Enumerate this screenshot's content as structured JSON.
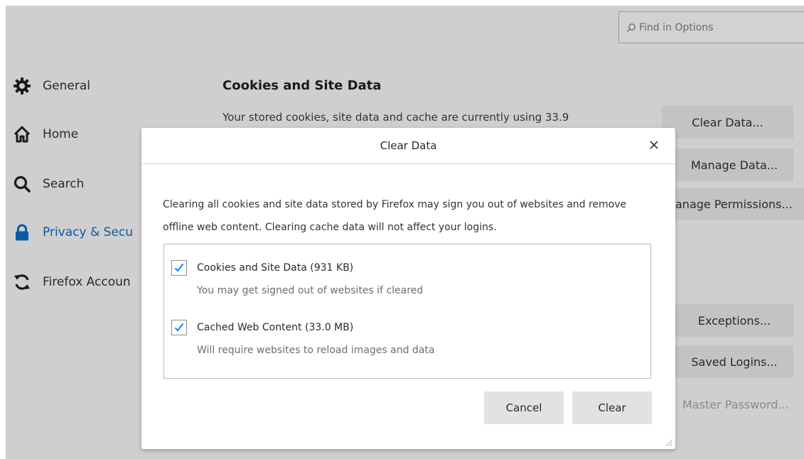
{
  "search": {
    "placeholder": "Find in Options"
  },
  "sidebar": {
    "items": [
      {
        "label": "General",
        "icon": "gear-icon"
      },
      {
        "label": "Home",
        "icon": "home-icon"
      },
      {
        "label": "Search",
        "icon": "search-icon"
      },
      {
        "label": "Privacy & Secu",
        "icon": "lock-icon",
        "active": true
      },
      {
        "label": "Firefox Accoun",
        "icon": "sync-icon"
      }
    ]
  },
  "content": {
    "section_title": "Cookies and Site Data",
    "section_desc": "Your stored cookies, site data and cache are currently using 33.9"
  },
  "side_buttons": {
    "clear_data": "Clear Data...",
    "manage_data": "Manage Data...",
    "manage_permissions": "anage Permissions...",
    "exceptions": "Exceptions...",
    "saved_logins": "Saved Logins...",
    "master_password": "Master Password..."
  },
  "dialog": {
    "title": "Clear Data",
    "close_glyph": "×",
    "message": "Clearing all cookies and site data stored by Firefox may sign you out of websites and remove offline web content. Clearing cache data will not affect your logins.",
    "options": [
      {
        "label": "Cookies and Site Data (931 KB)",
        "hint": "You may get signed out of websites if cleared",
        "checked": true
      },
      {
        "label": "Cached Web Content (33.0 MB)",
        "hint": "Will require websites to reload images and data",
        "checked": true
      }
    ],
    "cancel_label": "Cancel",
    "clear_label": "Clear"
  },
  "colors": {
    "accent": "#0a84ff",
    "active_nav": "#0a5aa8",
    "overlay": "#cfcfcf"
  }
}
